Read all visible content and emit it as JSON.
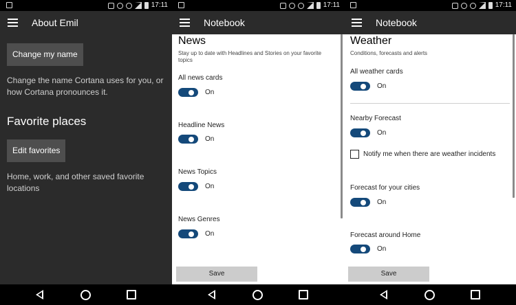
{
  "status_bar": {
    "time": "17:11"
  },
  "panel_about": {
    "title": "About Emil",
    "change_name_button": "Change my name",
    "change_name_desc": "Change the name Cortana uses for you, or how Cortana pronounces it.",
    "favorite_places_heading": "Favorite places",
    "edit_favorites_button": "Edit favorites",
    "favorites_desc": "Home, work, and other saved favorite locations"
  },
  "panel_news": {
    "title": "Notebook",
    "section_title": "News",
    "section_subtitle": "Stay up to date with Headlines and Stories on your favorite topics",
    "items": [
      {
        "label": "All news cards",
        "state": "On"
      },
      {
        "label": "Headline News",
        "state": "On"
      },
      {
        "label": "News Topics",
        "state": "On"
      },
      {
        "label": "News Genres",
        "state": "On"
      }
    ],
    "save_button": "Save"
  },
  "panel_weather": {
    "title": "Notebook",
    "section_title": "Weather",
    "section_subtitle": "Conditions, forecasts and alerts",
    "all_cards": {
      "label": "All weather cards",
      "state": "On"
    },
    "nearby": {
      "label": "Nearby Forecast",
      "state": "On"
    },
    "notify_label": "Notify me when there are weather incidents",
    "cities": {
      "label": "Forecast for your cities",
      "state": "On"
    },
    "home": {
      "label": "Forecast around Home",
      "state": "On"
    },
    "save_button": "Save"
  },
  "colors": {
    "toggle_on": "#14497a",
    "dark_bg": "#2b2b2b",
    "button_dark": "#4e4e4e"
  }
}
